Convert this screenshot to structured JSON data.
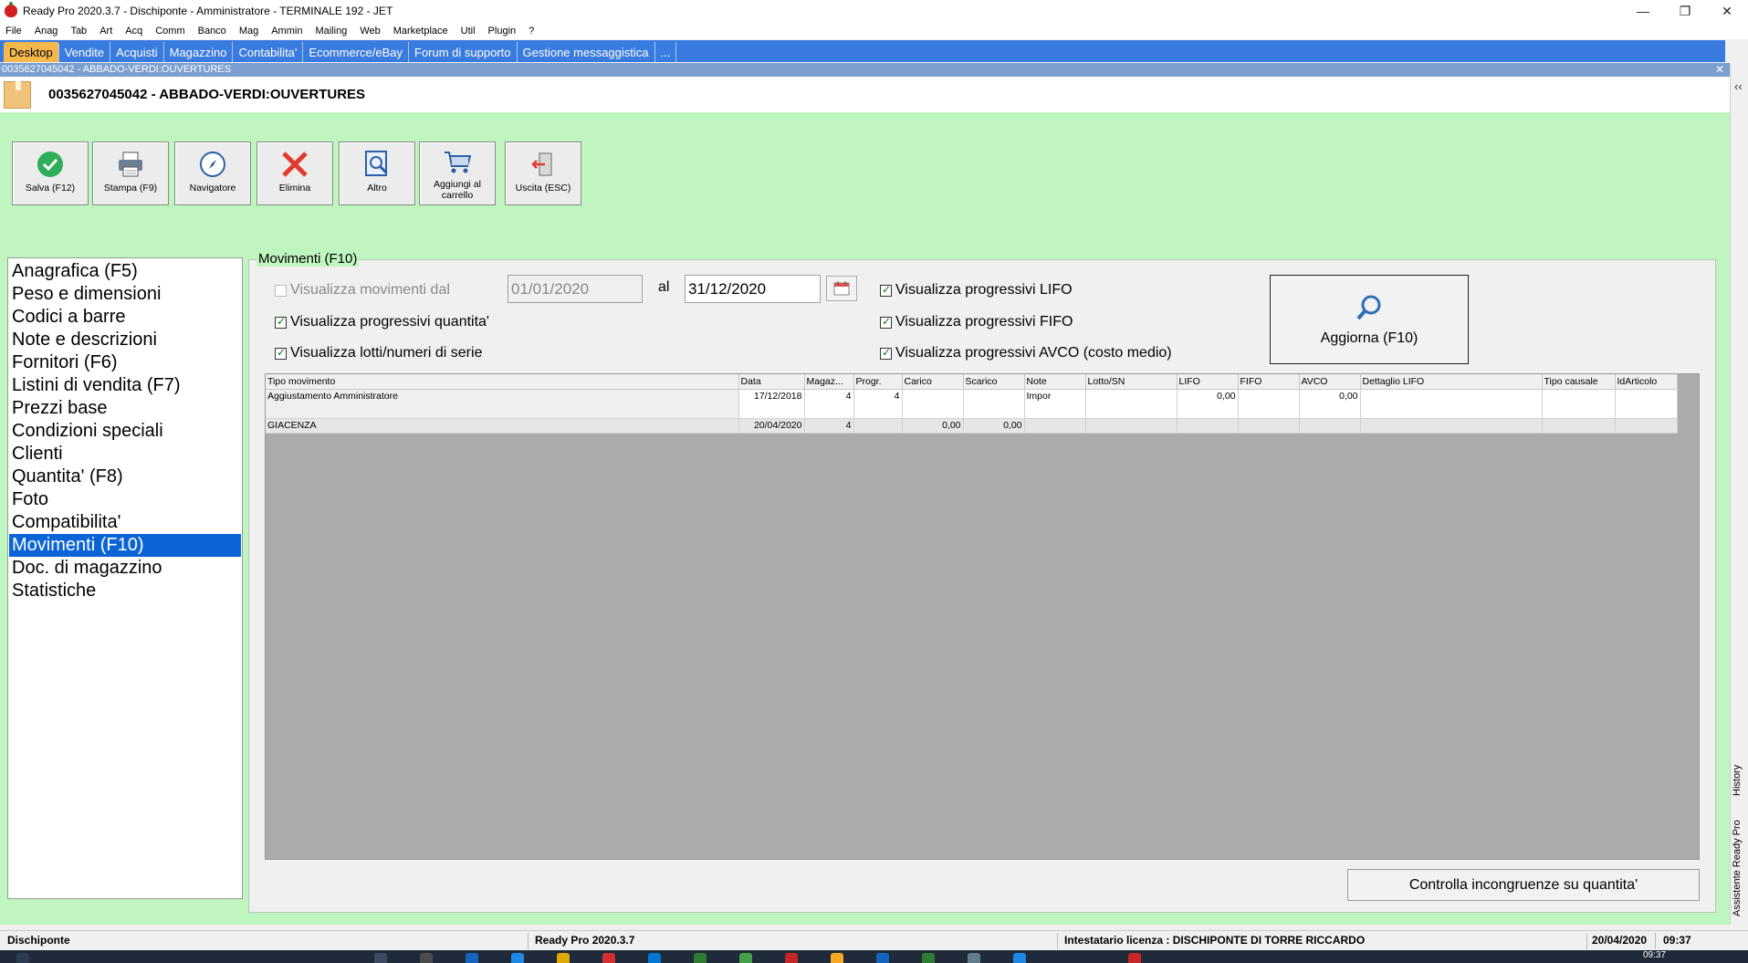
{
  "window": {
    "title": "Ready Pro 2020.3.7 - Dischiponte - Amministratore - TERMINALE 192 - JET",
    "min": "—",
    "restore": "❐",
    "close": "✕"
  },
  "menu": [
    "File",
    "Anag",
    "Tab",
    "Art",
    "Acq",
    "Comm",
    "Banco",
    "Mag",
    "Ammin",
    "Mailing",
    "Web",
    "Marketplace",
    "Util",
    "Plugin",
    "?"
  ],
  "tabs": [
    "Desktop",
    "Vendite",
    "Acquisti",
    "Magazzino",
    "Contabilita'",
    "Ecommerce/eBay",
    "Forum di supporto",
    "Gestione messaggistica",
    "..."
  ],
  "subwindow": {
    "header": "0035627045042 - ABBADO-VERDI:OUVERTURES",
    "close": "✕",
    "record_title": "0035627045042 - ABBADO-VERDI:OUVERTURES"
  },
  "toolbar": {
    "salva": "Salva (F12)",
    "stampa": "Stampa (F9)",
    "navigatore": "Navigatore",
    "elimina": "Elimina",
    "altro": "Altro",
    "aggiungi_1": "Aggiungi al",
    "aggiungi_2": "carrello",
    "uscita": "Uscita (ESC)"
  },
  "nav": [
    "Anagrafica (F5)",
    "Peso e dimensioni",
    "Codici a barre",
    "Note e descrizioni",
    "Fornitori (F6)",
    "Listini di vendita (F7)",
    "Prezzi base",
    "Condizioni speciali",
    "Clienti",
    "Quantita' (F8)",
    "Foto",
    "Compatibilita'",
    "Movimenti (F10)",
    "Doc. di magazzino",
    "Statistiche"
  ],
  "nav_selected": "Movimenti (F10)",
  "movimenti": {
    "group_title": "Movimenti (F10)",
    "chk_dal": "Visualizza movimenti dal",
    "date_from": "01/01/2020",
    "al": "al",
    "date_to": "31/12/2020",
    "chk_quantita": "Visualizza progressivi quantita'",
    "chk_lotti": "Visualizza lotti/numeri di serie",
    "chk_lifo": "Visualizza progressivi LIFO",
    "chk_fifo": "Visualizza progressivi FIFO",
    "chk_avco": "Visualizza progressivi AVCO (costo medio)",
    "aggiorna": "Aggiorna (F10)",
    "controlla": "Controlla incongruenze su quantita'"
  },
  "grid": {
    "columns": [
      "Tipo movimento",
      "Data",
      "Magaz...",
      "Progr.",
      "Carico",
      "Scarico",
      "Note",
      "Lotto/SN",
      "LIFO",
      "FIFO",
      "AVCO",
      "Dettaglio LIFO",
      "Tipo causale",
      "IdArticolo"
    ],
    "rows": [
      [
        "Aggiustamento Amministratore",
        "17/12/2018",
        "4",
        "4",
        "",
        "",
        "Impor",
        "",
        "0,00",
        "",
        "0,00",
        "",
        "",
        ""
      ],
      [
        "GIACENZA",
        "20/04/2020",
        "4",
        "",
        "0,00",
        "0,00",
        "",
        "",
        "",
        "",
        "",
        "",
        "",
        ""
      ]
    ]
  },
  "right_panel": {
    "chevron": "‹‹",
    "history": "History",
    "assistente": "Assistente Ready Pro"
  },
  "status": {
    "company": "Dischiponte",
    "version": "Ready Pro 2020.3.7",
    "license": "Intestatario licenza : DISCHIPONTE DI TORRE RICCARDO",
    "date": "20/04/2020",
    "time": "09:37"
  },
  "taskbar": {
    "time": "09:37"
  },
  "colors": {
    "tab_bar": "#3a7be0",
    "tab_active": "#f5b84c",
    "content_bg": "#bff5bf",
    "selection": "#0a64d6"
  }
}
